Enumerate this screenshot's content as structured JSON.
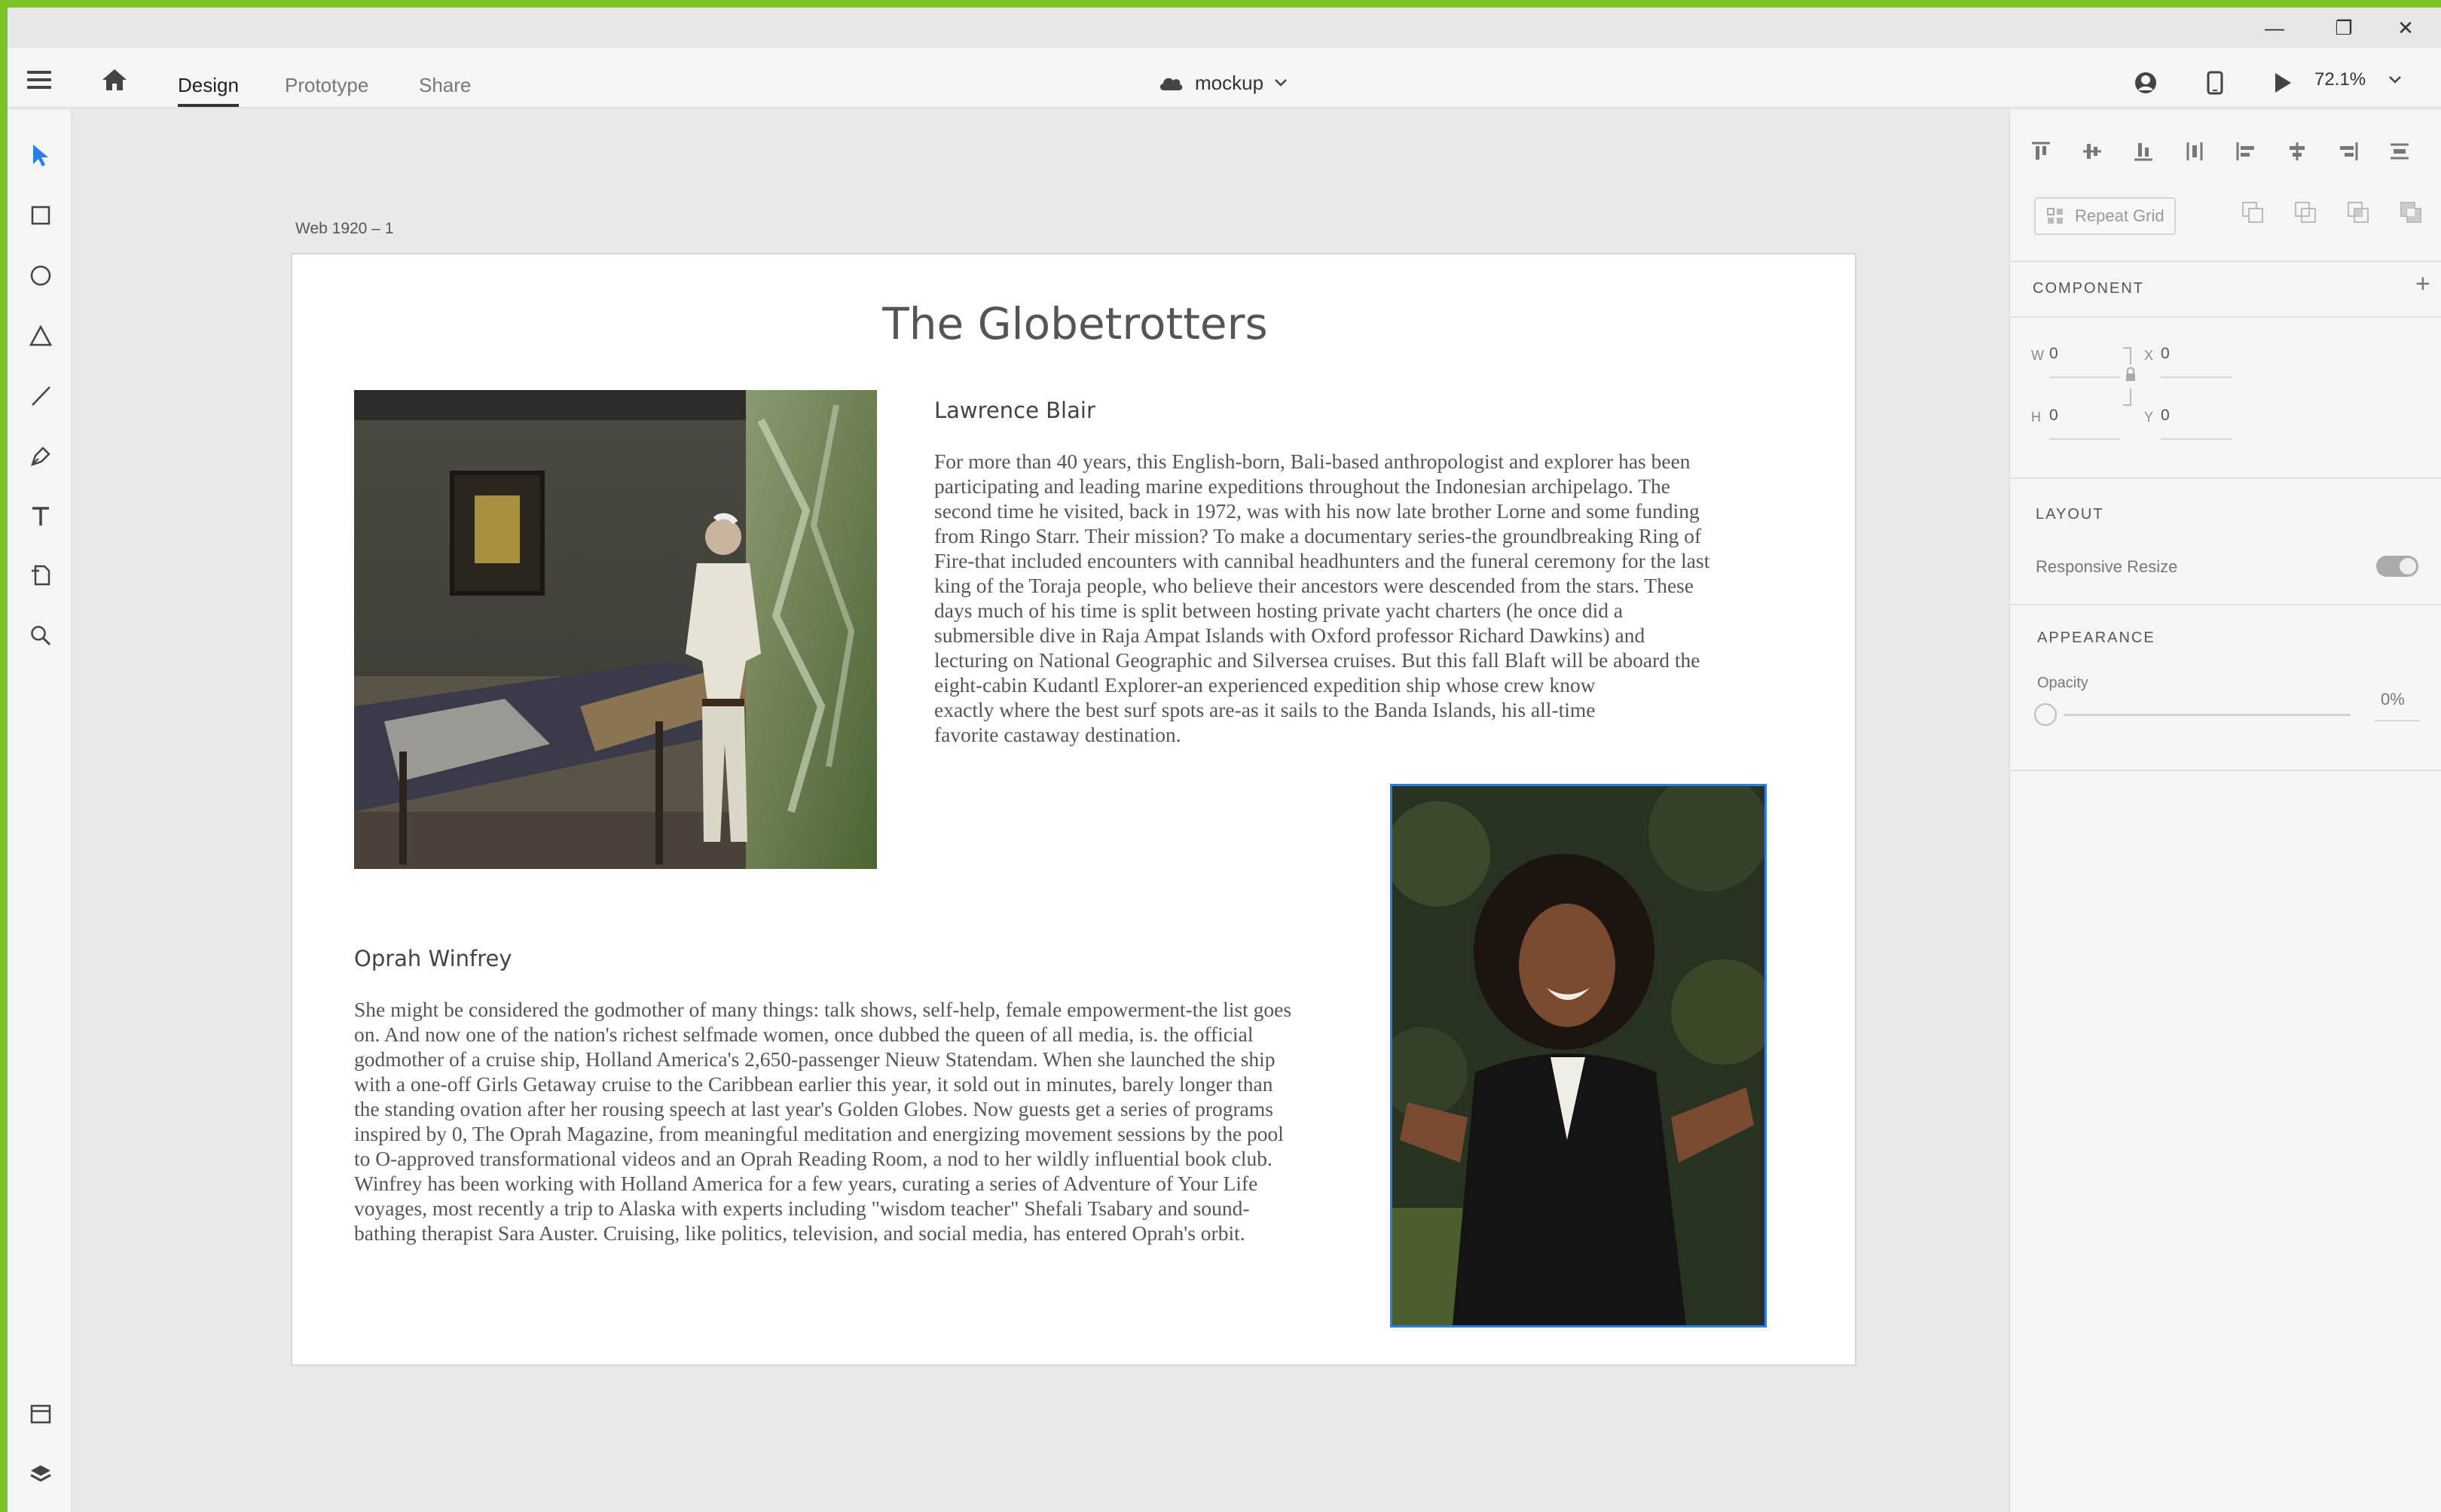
{
  "window": {
    "minimize_glyph": "—",
    "restore_glyph": "❐",
    "close_glyph": "✕"
  },
  "header": {
    "tabs": [
      {
        "label": "Design",
        "active": true
      },
      {
        "label": "Prototype",
        "active": false
      },
      {
        "label": "Share",
        "active": false
      }
    ],
    "document_name": "mockup",
    "zoom": "72.1%",
    "icons": [
      "menu-icon",
      "home-icon",
      "cloud-icon",
      "chevron-down-icon",
      "user-icon",
      "mobile-preview-icon",
      "play-icon"
    ]
  },
  "toolbar": {
    "tools": [
      "select-tool-icon",
      "rectangle-tool-icon",
      "ellipse-tool-icon",
      "polygon-tool-icon",
      "line-tool-icon",
      "pen-tool-icon",
      "text-tool-icon",
      "artboard-tool-icon",
      "zoom-tool-icon"
    ],
    "bottom": [
      "assets-icon",
      "layers-icon"
    ],
    "active_color": "#2680eb"
  },
  "canvas": {
    "artboard_label": "Web 1920 – 1",
    "page_title": "The Globetrotters",
    "person1": {
      "name": "Lawrence Blair",
      "lines": [
        "For more than 40 years, this English-born, Bali-based anthropologist and explorer has been",
        "participating and leading marine expeditions throughout the Indonesian archipelago. The",
        "second time he visited, back in 1972, was with his now late brother Lorne and some funding",
        "from Ringo Starr. Their mission? To make a documentary series-the groundbreaking Ring of",
        "Fire-that included encounters with cannibal headhunters and the funeral ceremony for the last",
        "king of the Toraja people, who believe their ancestors were descended from the stars. These",
        "days much of his time is split between hosting private yacht charters (he once did a",
        "submersible dive in Raja Ampat Islands with Oxford professor Richard Dawkins) and",
        "lecturing on National Geographic and Silversea cruises. But this fall Blaft will be aboard the",
        "eight-cabin Kudantl Explorer-an experienced expedition ship whose crew know",
        "exactly where the best surf spots are-as it sails to the Banda Islands, his all-time",
        "favorite castaway destination."
      ]
    },
    "person2": {
      "name": "Oprah Winfrey",
      "lines": [
        "She might be considered the godmother of many things: talk shows, self-help, female empowerment-the list goes",
        "on. And now one of the nation's richest selfmade women, once dubbed the queen of all media, is. the official",
        "godmother of a cruise ship, Holland America's 2,650-passenger Nieuw Statendam. When she launched the ship",
        "with a one-off Girls Getaway cruise to the Caribbean earlier this year, it sold out in minutes, barely longer than",
        "the standing ovation after her rousing speech at last year's Golden Globes. Now guests get a series of programs",
        "inspired by 0, The Oprah Magazine, from meaningful meditation and energizing movement sessions by the pool",
        "to O-approved transformational videos and an Oprah Reading Room, a nod to her wildly influential book club.",
        "Winfrey has been working with Holland America for a few years, curating a series of Adventure of Your Life",
        "voyages, most recently a trip to Alaska with experts including \"wisdom teacher\" Shefali Tsabary and sound-",
        "bathing therapist Sara Auster. Cruising, like politics, television, and social media, has entered Oprah's orbit."
      ]
    }
  },
  "panel": {
    "repeat_grid": "Repeat Grid",
    "component": {
      "title": "COMPONENT",
      "add": "+"
    },
    "transform": {
      "w_label": "W",
      "w": "0",
      "h_label": "H",
      "h": "0",
      "x_label": "X",
      "x": "0",
      "y_label": "Y",
      "y": "0"
    },
    "layout": {
      "title": "LAYOUT",
      "responsive_resize": "Responsive Resize",
      "responsive_on": true
    },
    "appearance": {
      "title": "APPEARANCE",
      "opacity_label": "Opacity",
      "opacity_value": "0%",
      "opacity": 0
    }
  }
}
